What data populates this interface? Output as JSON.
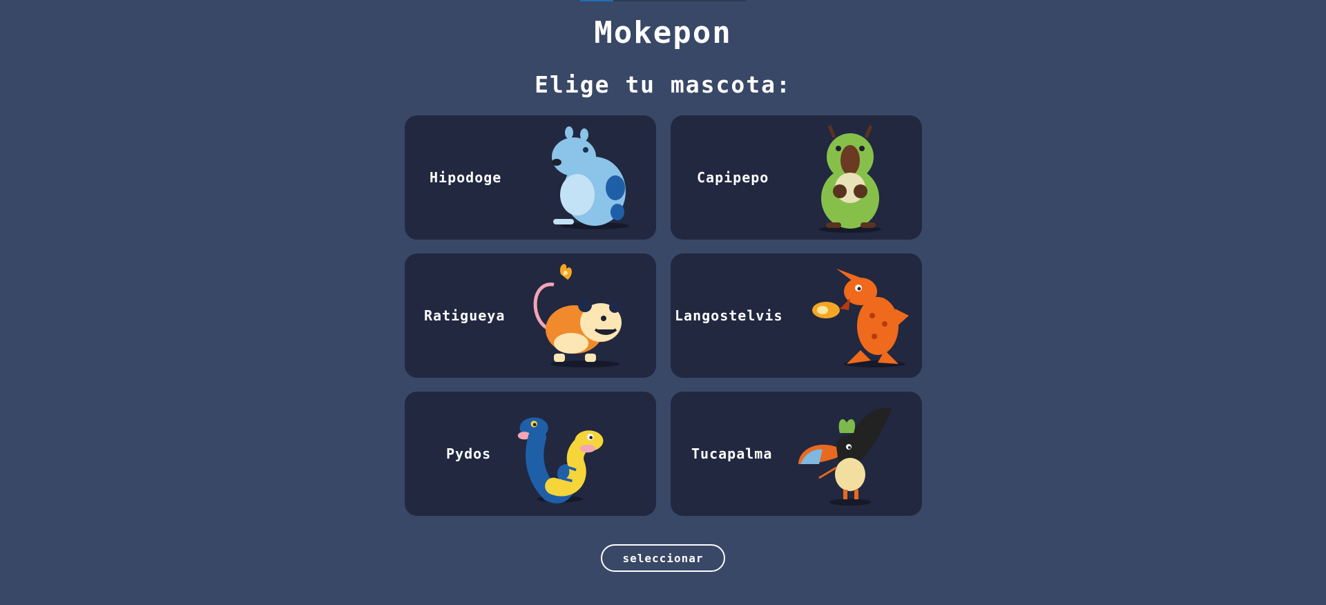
{
  "game": {
    "title": "Mokepon",
    "subtitle": "Elige tu mascota:"
  },
  "pets": [
    {
      "name": "Hipodoge",
      "icon": "hipodoge-icon",
      "color": "#7fb8e0"
    },
    {
      "name": "Capipepo",
      "icon": "capipepo-icon",
      "color": "#86c04b"
    },
    {
      "name": "Ratigueya",
      "icon": "ratigueya-icon",
      "color": "#f08a2c"
    },
    {
      "name": "Langostelvis",
      "icon": "langostelvis-icon",
      "color": "#ef6a1c"
    },
    {
      "name": "Pydos",
      "icon": "pydos-icon",
      "color": "#f5d53a"
    },
    {
      "name": "Tucapalma",
      "icon": "tucapalma-icon",
      "color": "#222222"
    }
  ],
  "actions": {
    "select_label": "seleccionar"
  },
  "colors": {
    "background": "#394867",
    "card": "#212840",
    "text": "#ffffff"
  }
}
